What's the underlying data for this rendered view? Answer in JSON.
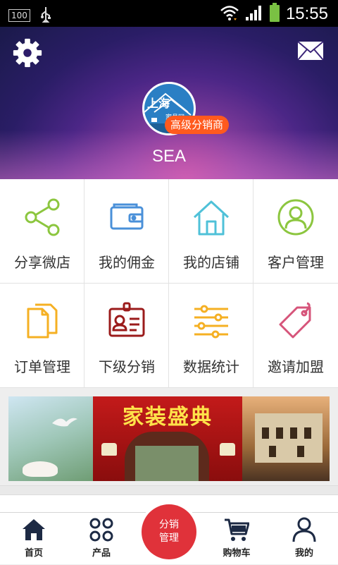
{
  "status_bar": {
    "battery_badge": "100",
    "time": "15:55"
  },
  "profile": {
    "logo_text_main": "上海",
    "logo_text_sub": "家具网",
    "level_badge": "高级分销商",
    "username": "SEA"
  },
  "menu": {
    "row1": [
      {
        "label": "分享微店",
        "icon": "share-icon"
      },
      {
        "label": "我的佣金",
        "icon": "wallet-icon"
      },
      {
        "label": "我的店铺",
        "icon": "house-icon"
      },
      {
        "label": "客户管理",
        "icon": "user-circle-icon"
      }
    ],
    "row2": [
      {
        "label": "订单管理",
        "icon": "documents-icon"
      },
      {
        "label": "下级分销",
        "icon": "id-badge-icon"
      },
      {
        "label": "数据统计",
        "icon": "sliders-icon"
      },
      {
        "label": "邀请加盟",
        "icon": "tag-icon"
      }
    ]
  },
  "banner": {
    "title": "家装盛典"
  },
  "tab_bar": {
    "home": "首页",
    "products": "产品",
    "center": "分销管理",
    "cart": "购物车",
    "mine": "我的"
  },
  "colors": {
    "green": "#8cc63f",
    "blue": "#4a90d9",
    "teal": "#4fc1d8",
    "orange": "#f5b023",
    "dark_red": "#9b1b1b",
    "pink": "#d6547a",
    "center_red": "#e0323a"
  }
}
